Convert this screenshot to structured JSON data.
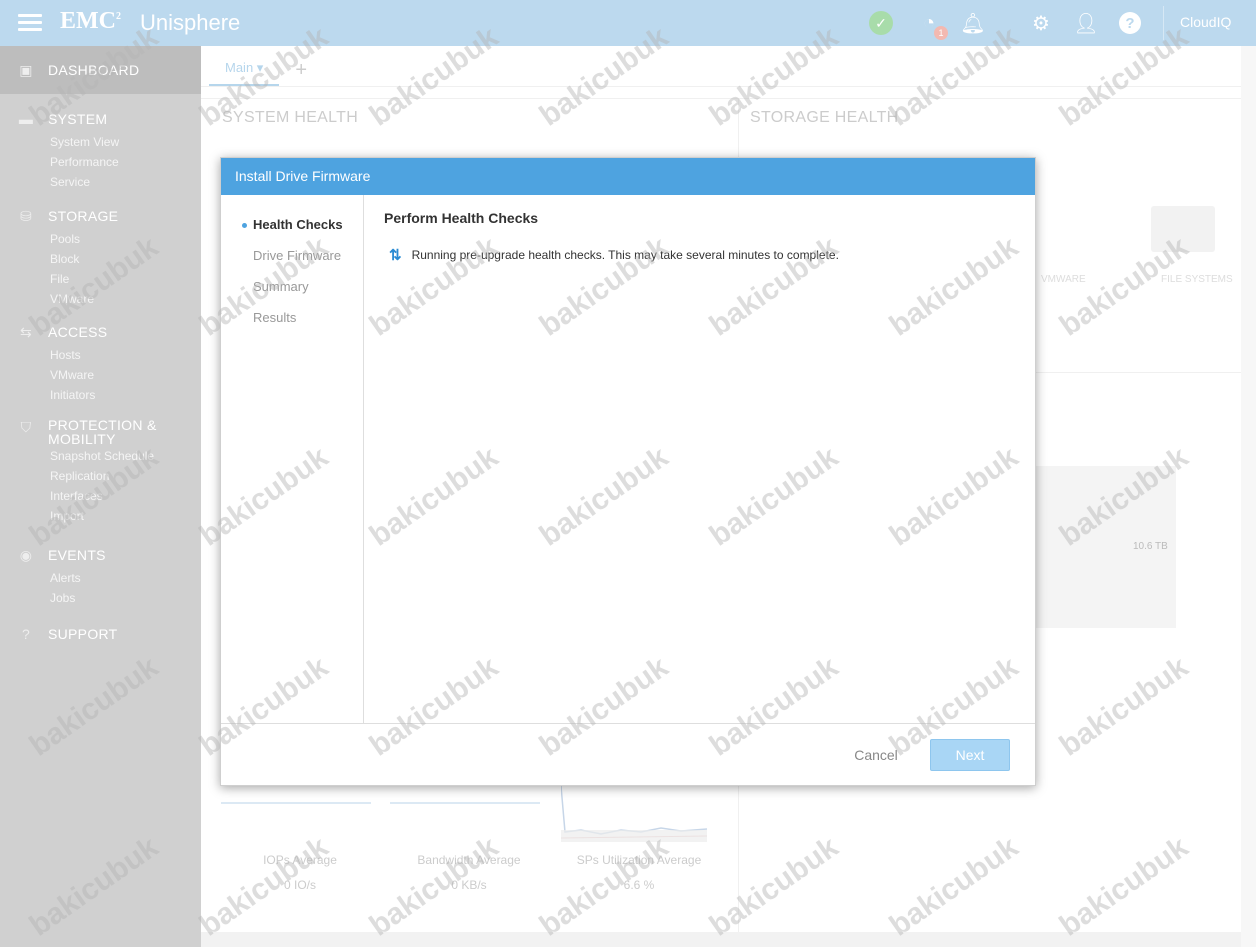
{
  "header": {
    "brand": "EMC",
    "brand_sup": "2",
    "app_name": "Unisphere",
    "alerts_badge": "1",
    "cloudiq_label": "CloudIQ"
  },
  "sidebar": {
    "dashboard": "DASHBOARD",
    "system": {
      "label": "SYSTEM",
      "items": [
        "System View",
        "Performance",
        "Service"
      ]
    },
    "storage": {
      "label": "STORAGE",
      "items": [
        "Pools",
        "Block",
        "File",
        "VMware"
      ]
    },
    "access": {
      "label": "ACCESS",
      "items": [
        "Hosts",
        "VMware",
        "Initiators"
      ]
    },
    "protection": {
      "label_line1": "PROTECTION &",
      "label_line2": "MOBILITY",
      "items": [
        "Snapshot Schedule",
        "Replication",
        "Interfaces",
        "Import"
      ]
    },
    "events": {
      "label": "EVENTS",
      "items": [
        "Alerts",
        "Jobs"
      ]
    },
    "support": {
      "label": "SUPPORT"
    }
  },
  "main": {
    "tab_main": "Main",
    "tab_add": "+",
    "system_health": "SYSTEM HEALTH",
    "storage_health": "STORAGE HEALTH",
    "vmware_label": "VMWARE",
    "file_systems_label": "FILE SYSTEMS",
    "capacity_value": "10.6 TB",
    "metrics": [
      {
        "label": "IOPs Average",
        "value": "0 IO/s"
      },
      {
        "label": "Bandwidth Average",
        "value": "0 KB/s"
      },
      {
        "label": "SPs Utilization Average",
        "value": "6.6 %"
      }
    ]
  },
  "dialog": {
    "title": "Install Drive Firmware",
    "steps": [
      "Health Checks",
      "Drive Firmware",
      "Summary",
      "Results"
    ],
    "active_step": "Health Checks",
    "section_title": "Perform Health Checks",
    "status_text": "Running pre-upgrade health checks. This may take several minutes to complete.",
    "cancel_label": "Cancel",
    "next_label": "Next"
  },
  "watermark": "bakicubuk"
}
